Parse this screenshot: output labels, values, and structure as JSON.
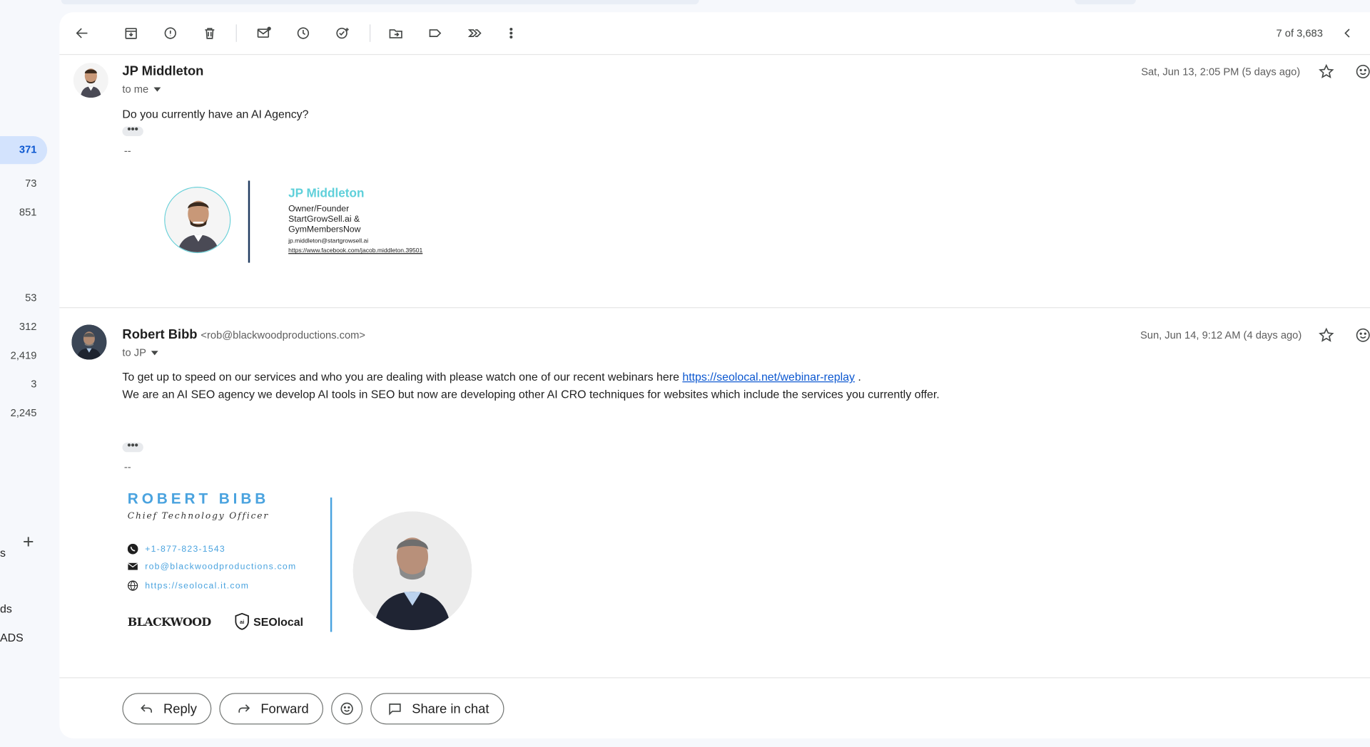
{
  "sidebar": {
    "active_count": "371",
    "counts": [
      "73",
      "851",
      "53",
      "312",
      "2,419",
      "3",
      "2,245"
    ],
    "fragments": [
      "s",
      "ds",
      "ADS"
    ]
  },
  "toolbar": {
    "pager": "7 of 3,683"
  },
  "messages": [
    {
      "sender": "JP Middleton",
      "email": "",
      "to": "to me",
      "date": "Sat, Jun 13, 2:05 PM (5 days ago)",
      "body": [
        "Do you currently have an AI Agency?"
      ],
      "dashes": "--",
      "signature": {
        "name": "JP Middleton",
        "title": "Owner/Founder",
        "company_line1": "StartGrowSell.ai &",
        "company_line2": "GymMembersNow",
        "email": "jp.middleton@startgrowsell.ai",
        "link": "https://www.facebook.com/jacob.middleton.39501"
      }
    },
    {
      "sender": "Robert Bibb",
      "email": "<rob@blackwoodproductions.com>",
      "to": "to JP",
      "date": "Sun, Jun 14, 9:12 AM (4 days ago)",
      "body_line1_pre": "To get up to speed on our services and who you are dealing with please watch one of our recent webinars here ",
      "body_link": "https://seolocal.net/webinar-replay",
      "body_line1_post": " .",
      "body_line2": "We are an AI SEO agency we develop AI tools in SEO but now are developing other AI CRO techniques for websites which include the services you currently offer.",
      "dashes": "--",
      "signature": {
        "name": "ROBERT BIBB",
        "title": "Chief Technology Officer",
        "phone": "+1-877-823-1543",
        "email": "rob@blackwoodproductions.com",
        "website": "https://seolocal.it.com",
        "logo1": "BLACKWOOD",
        "logo2": "SEOlocal"
      }
    }
  ],
  "actions": {
    "reply": "Reply",
    "forward": "Forward",
    "share": "Share in chat"
  },
  "colors": {
    "accent_blue": "#0b57d0",
    "active_bg": "#d3e3fd",
    "sig_teal": "#5fd0da",
    "sig_blue": "#4aa3df"
  }
}
